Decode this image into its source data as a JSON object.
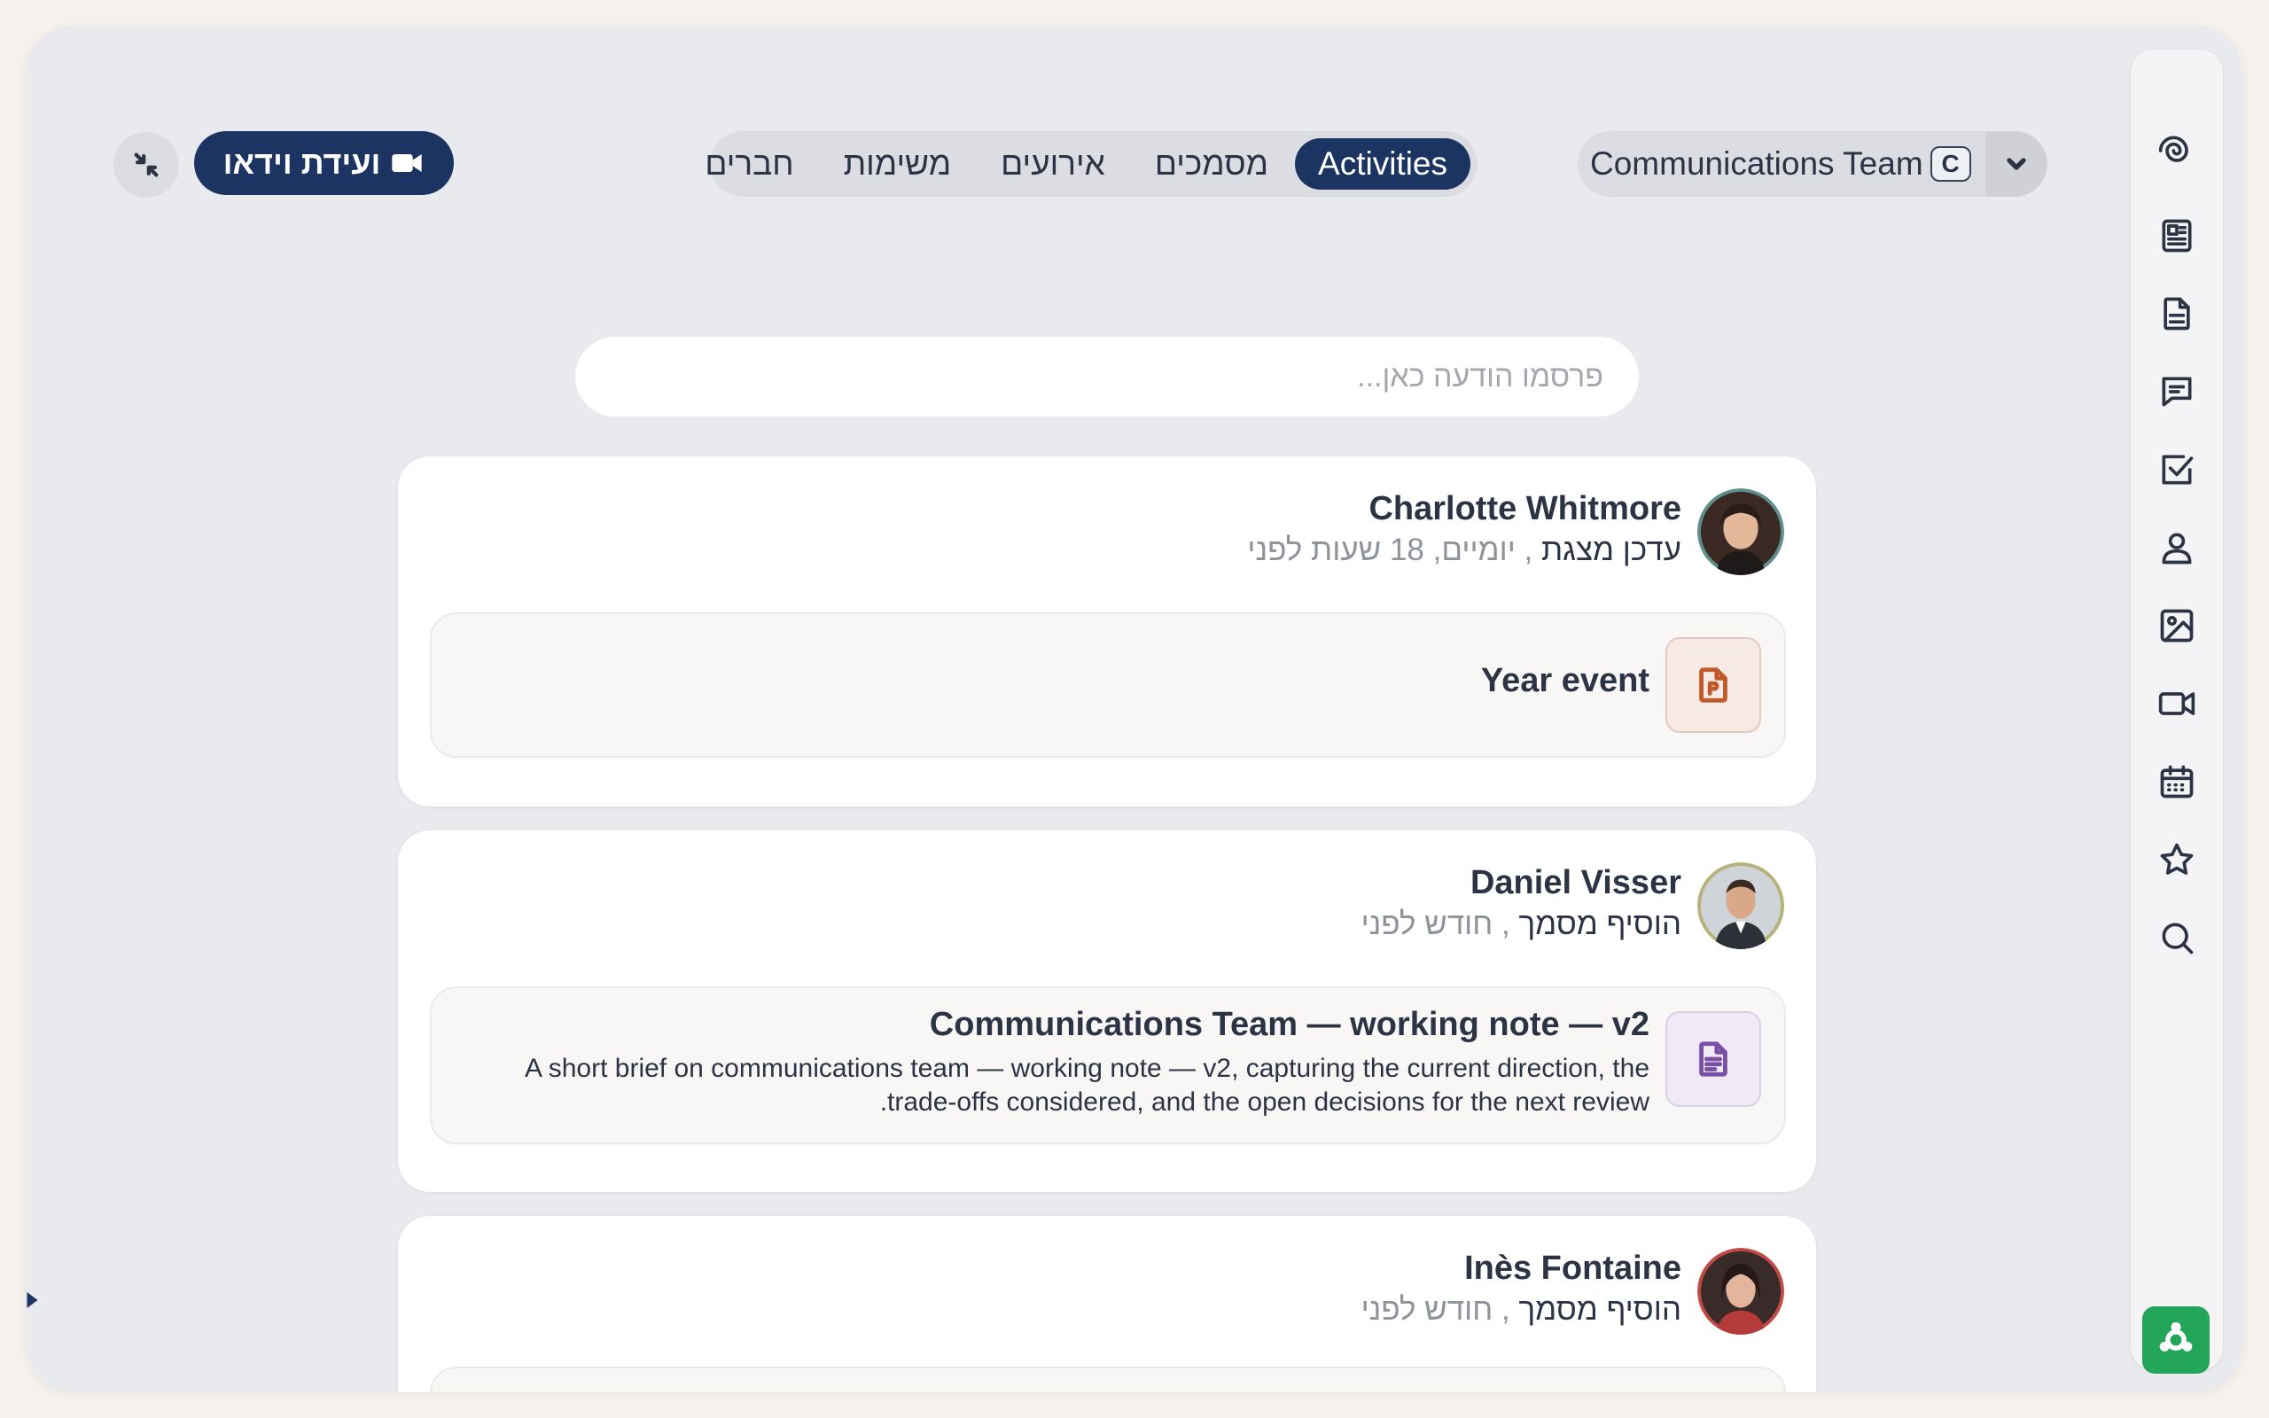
{
  "header": {
    "video_button_label": "ועידת וידאו",
    "tabs": [
      {
        "label": "Activities",
        "active": true
      },
      {
        "label": "מסמכים",
        "active": false
      },
      {
        "label": "אירועים",
        "active": false
      },
      {
        "label": "משימות",
        "active": false
      },
      {
        "label": "חברים",
        "active": false
      }
    ],
    "team_select": {
      "label": "Communications Team",
      "badge": "C"
    }
  },
  "composer": {
    "placeholder": "פרסמו הודעה כאן..."
  },
  "feed": [
    {
      "author": "Charlotte Whitmore",
      "action": "עדכן מצגת",
      "time": ", יומיים, 18 שעות לפני",
      "attachment": {
        "type": "presentation",
        "icon": "presentation-file-icon",
        "title": "Year event",
        "description": ""
      }
    },
    {
      "author": "Daniel Visser",
      "action": "הוסיף מסמך",
      "time": ", חודש לפני",
      "attachment": {
        "type": "document",
        "icon": "document-file-icon",
        "title": "Communications Team — working note — v2",
        "description": "A short brief on communications team — working note — v2, capturing the current direction, the trade-offs considered, and the open decisions for the next review."
      }
    },
    {
      "author": "Inès Fontaine",
      "action": "הוסיף מסמך",
      "time": ", חודש לפני",
      "attachment": null
    }
  ],
  "rail": {
    "icons": [
      "swirl-icon",
      "newspaper-icon",
      "document-icon",
      "chat-icon",
      "checkbox-icon",
      "user-icon",
      "image-icon",
      "video-icon",
      "calendar-icon",
      "star-icon",
      "search-icon"
    ],
    "bottom_action_icon": "network-icon"
  },
  "colors": {
    "accent": "#1c3461",
    "green": "#23a55a",
    "presentation": "#c05a2b",
    "document": "#7a4fa8"
  }
}
